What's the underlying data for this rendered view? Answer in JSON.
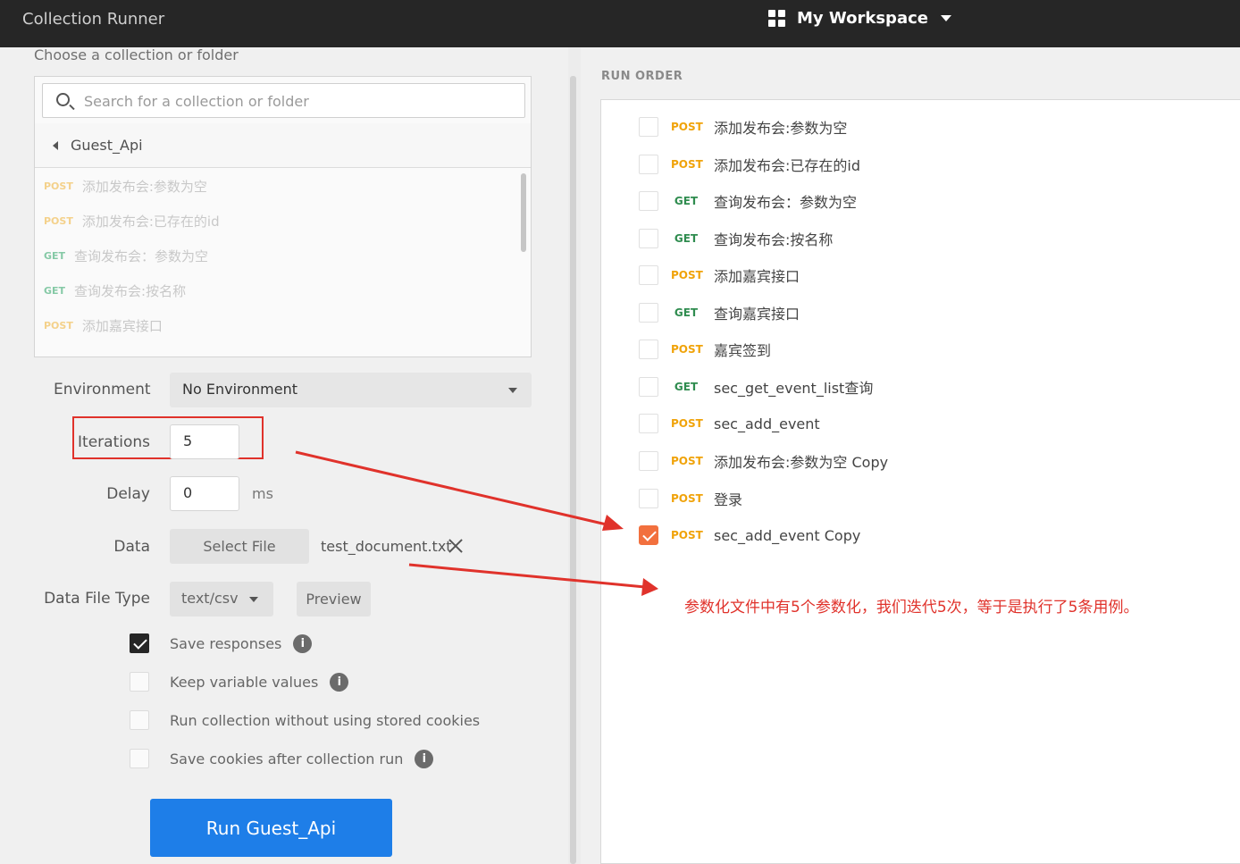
{
  "header": {
    "app_title": "Collection Runner",
    "workspace_label": "My Workspace"
  },
  "left": {
    "choose_label": "Choose a collection or folder",
    "search_placeholder": "Search for a collection or folder",
    "folder_name": "Guest_Api",
    "requests": [
      {
        "method": "POST",
        "name": "添加发布会:参数为空"
      },
      {
        "method": "POST",
        "name": "添加发布会:已存在的id"
      },
      {
        "method": "GET",
        "name": "查询发布会：参数为空"
      },
      {
        "method": "GET",
        "name": "查询发布会:按名称"
      },
      {
        "method": "POST",
        "name": "添加嘉宾接口"
      }
    ],
    "environment_label": "Environment",
    "environment_value": "No Environment",
    "iterations_label": "Iterations",
    "iterations_value": "5",
    "delay_label": "Delay",
    "delay_value": "0",
    "delay_unit": "ms",
    "data_label": "Data",
    "select_file_label": "Select File",
    "file_name": "test_document.txt",
    "data_file_type_label": "Data File Type",
    "data_file_type_value": "text/csv",
    "preview_label": "Preview",
    "options": [
      {
        "label": "Save responses",
        "checked": true,
        "info": true
      },
      {
        "label": "Keep variable values",
        "checked": false,
        "info": true
      },
      {
        "label": "Run collection without using stored cookies",
        "checked": false,
        "info": false
      },
      {
        "label": "Save cookies after collection run",
        "checked": false,
        "info": true
      }
    ],
    "run_button_label": "Run Guest_Api"
  },
  "right": {
    "run_order_label": "RUN ORDER",
    "items": [
      {
        "method": "POST",
        "name": "添加发布会:参数为空",
        "checked": false
      },
      {
        "method": "POST",
        "name": "添加发布会:已存在的id",
        "checked": false
      },
      {
        "method": "GET",
        "name": "查询发布会：参数为空",
        "checked": false
      },
      {
        "method": "GET",
        "name": "查询发布会:按名称",
        "checked": false
      },
      {
        "method": "POST",
        "name": "添加嘉宾接口",
        "checked": false
      },
      {
        "method": "GET",
        "name": "查询嘉宾接口",
        "checked": false
      },
      {
        "method": "POST",
        "name": "嘉宾签到",
        "checked": false
      },
      {
        "method": "GET",
        "name": "sec_get_event_list查询",
        "checked": false
      },
      {
        "method": "POST",
        "name": "sec_add_event",
        "checked": false
      },
      {
        "method": "POST",
        "name": "添加发布会:参数为空 Copy",
        "checked": false
      },
      {
        "method": "POST",
        "name": "登录",
        "checked": false
      },
      {
        "method": "POST",
        "name": "sec_add_event Copy",
        "checked": true
      }
    ]
  },
  "annotation": {
    "text": "参数化文件中有5个参数化，我们迭代5次，等于是执行了5条用例。",
    "color": "#e0322b"
  },
  "info_glyph": "i"
}
